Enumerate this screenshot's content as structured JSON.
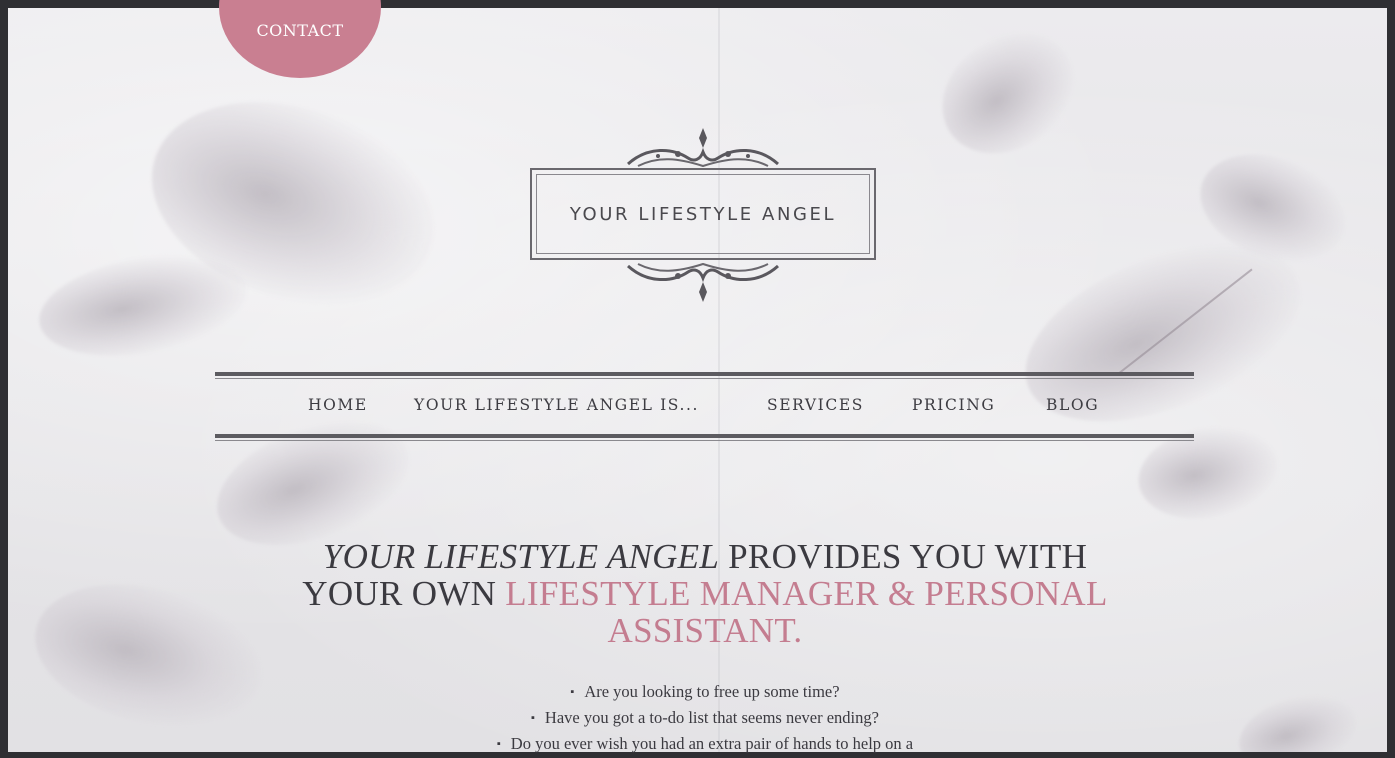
{
  "contact_label": "CONTACT",
  "logo": {
    "text": "YOUR LIFESTYLE ANGEL"
  },
  "nav": {
    "items": [
      "HOME",
      "YOUR LIFESTYLE ANGEL IS...",
      "SERVICES",
      "PRICING",
      "BLOG"
    ]
  },
  "headline": {
    "part1_italic": "YOUR LIFESTYLE ANGEL",
    "part2": " PROVIDES YOU WITH YOUR OWN ",
    "part3_pink": "LIFESTYLE MANAGER & PERSONAL ASSISTANT."
  },
  "bullets": [
    "Are you looking to free up some time?",
    "Have you got a to-do list that seems never ending?",
    "Do you ever wish you had an extra pair of hands to help on a"
  ],
  "colors": {
    "accent": "#c97f91",
    "text": "#3b3a40",
    "frame": "#2f2f33"
  }
}
